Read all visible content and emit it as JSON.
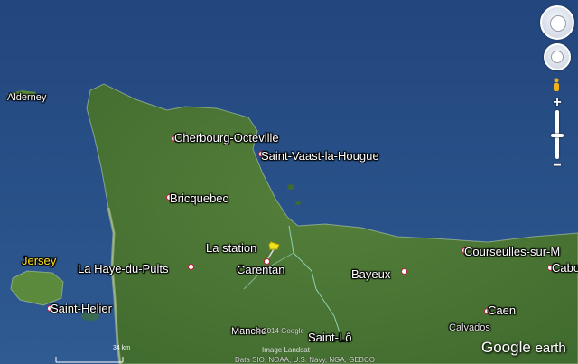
{
  "places": {
    "alderney": "Alderney",
    "cherbourg": "Cherbourg-Octeville",
    "saint_vaast": "Saint-Vaast-la-Hougue",
    "bricquebec": "Bricquebec",
    "la_station": "La station",
    "carentan": "Carentan",
    "la_haye": "La Haye-du-Puits",
    "jersey": "Jersey",
    "saint_helier": "Saint-Helier",
    "bayeux": "Bayeux",
    "courseulles": "Courseulles-sur-M",
    "cabo": "Cabo",
    "caen": "Caen",
    "calvados": "Calvados",
    "saint_lo": "Saint-Lô",
    "manche": "Manche"
  },
  "attribution": {
    "copyright": "© 2014 Google",
    "imagery": "Image Landsat",
    "data": "Data SIO, NOAA, U.S. Navy, NGA, GEBCO"
  },
  "scale": {
    "label": "34 km"
  },
  "logo": {
    "google": "Google",
    "earth": "earth"
  },
  "colors": {
    "sea": "#2a4f86",
    "land": "#4f7a38",
    "pin": "#f2e21b",
    "label_highlight": "#ffe11a"
  },
  "icons": {
    "pin": "pushpin-icon",
    "compass": "compass-icon",
    "pan": "pan-control-icon",
    "pegman": "pegman-icon"
  }
}
